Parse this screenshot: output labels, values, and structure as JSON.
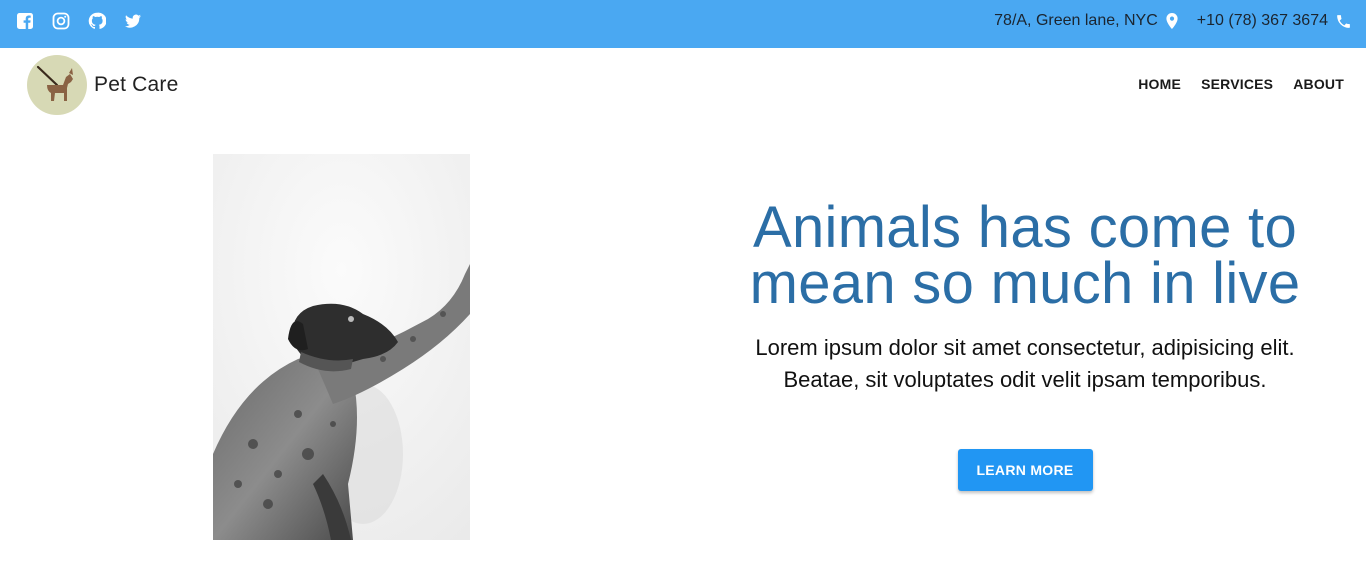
{
  "topbar": {
    "background": "#4aa8f2",
    "social_icons": [
      "facebook-icon",
      "instagram-icon",
      "github-icon",
      "twitter-icon"
    ],
    "address": "78/A, Green lane, NYC",
    "address_icon": "map-pin-icon",
    "phone": "+10 (78) 367 3674",
    "phone_icon": "phone-icon"
  },
  "navbar": {
    "brand_name": "Pet Care",
    "logo_icon": "dog-walking-logo",
    "links": [
      "HOME",
      "SERVICES",
      "ABOUT"
    ]
  },
  "hero": {
    "image": "dog-photo",
    "headline_line1": "Animals has come to",
    "headline_line2": "mean so much in live",
    "subtext_line1": "Lorem ipsum dolor sit amet consectetur, adipisicing elit.",
    "subtext_line2": "Beatae, sit voluptates odit velit ipsam temporibus.",
    "cta_label": "LEARN MORE",
    "headline_color": "#2b6ea6",
    "cta_color": "#2196f3"
  }
}
